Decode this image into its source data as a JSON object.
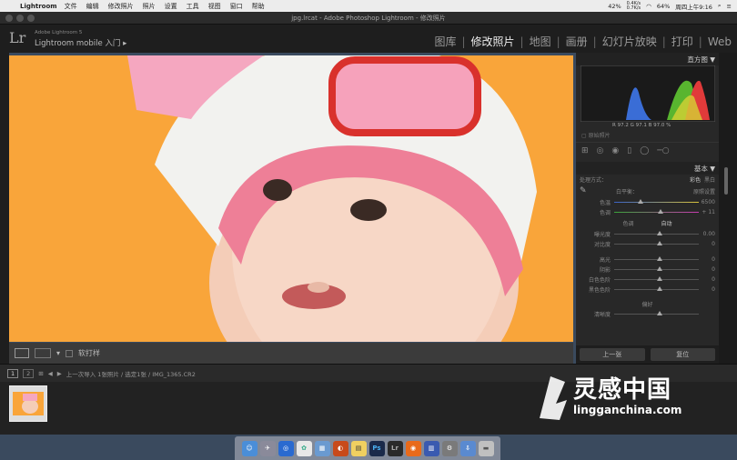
{
  "menubar": {
    "apple": "",
    "app": "Lightroom",
    "items": [
      "文件",
      "编辑",
      "修改照片",
      "照片",
      "设置",
      "工具",
      "视图",
      "窗口",
      "帮助"
    ],
    "battery": "42%",
    "network": "0.4K/s",
    "network2": "0.7K/s",
    "battery2": "64%",
    "clock": "周四上午9:16"
  },
  "window_title": "jpg.lrcat - Adobe Photoshop Lightroom - 修改照片",
  "identity": {
    "logo": "Lr",
    "version": "Adobe Lightroom 5",
    "mobile": "Lightroom mobile 入门"
  },
  "modules": [
    "图库",
    "修改照片",
    "地图",
    "画册",
    "幻灯片放映",
    "打印",
    "Web"
  ],
  "active_module": "修改照片",
  "toolbar": {
    "softproof": "软打样"
  },
  "right_panel": {
    "histogram_title": "直方图",
    "hist_readout": "R 97.2 G 97.1 B 97.0 %",
    "original": "原始照片",
    "basic_title": "基本",
    "treatment": "处理方式：",
    "color": "彩色",
    "bw": "黑白",
    "wb": "白平衡：",
    "wb_val": "原照设置",
    "temp": "色温",
    "temp_val": "6500",
    "tint": "色调",
    "tint_val": "+ 11",
    "tone": "色调",
    "auto": "自动",
    "exposure": "曝光度",
    "exposure_val": "0.00",
    "contrast": "对比度",
    "contrast_val": "0",
    "highlights": "高光",
    "shadows": "阴影",
    "whites": "白色色阶",
    "blacks": "黑色色阶",
    "zero": "0",
    "presence": "偏好",
    "clarity": "清晰度",
    "prev": "上一张",
    "reset": "复位"
  },
  "filmstrip": {
    "p1": "1",
    "p2": "2",
    "info": "上一次导入  1张照片 / 选定1张 / IMG_1365.CR2"
  },
  "watermark": {
    "text": "灵感中国",
    "url": "lingganchina.com"
  },
  "dock_icons": [
    "finder-icon",
    "launchpad-icon",
    "safari-icon",
    "photos-icon",
    "gallery-icon",
    "qq-icon",
    "notes-icon",
    "photoshop-icon",
    "lightroom-icon",
    "firefox-icon",
    "ibooks-icon",
    "settings-icon",
    "downloads-icon",
    "trash-icon"
  ],
  "colors": {
    "photo_bg": "#f9a53a",
    "panel": "#282828"
  }
}
